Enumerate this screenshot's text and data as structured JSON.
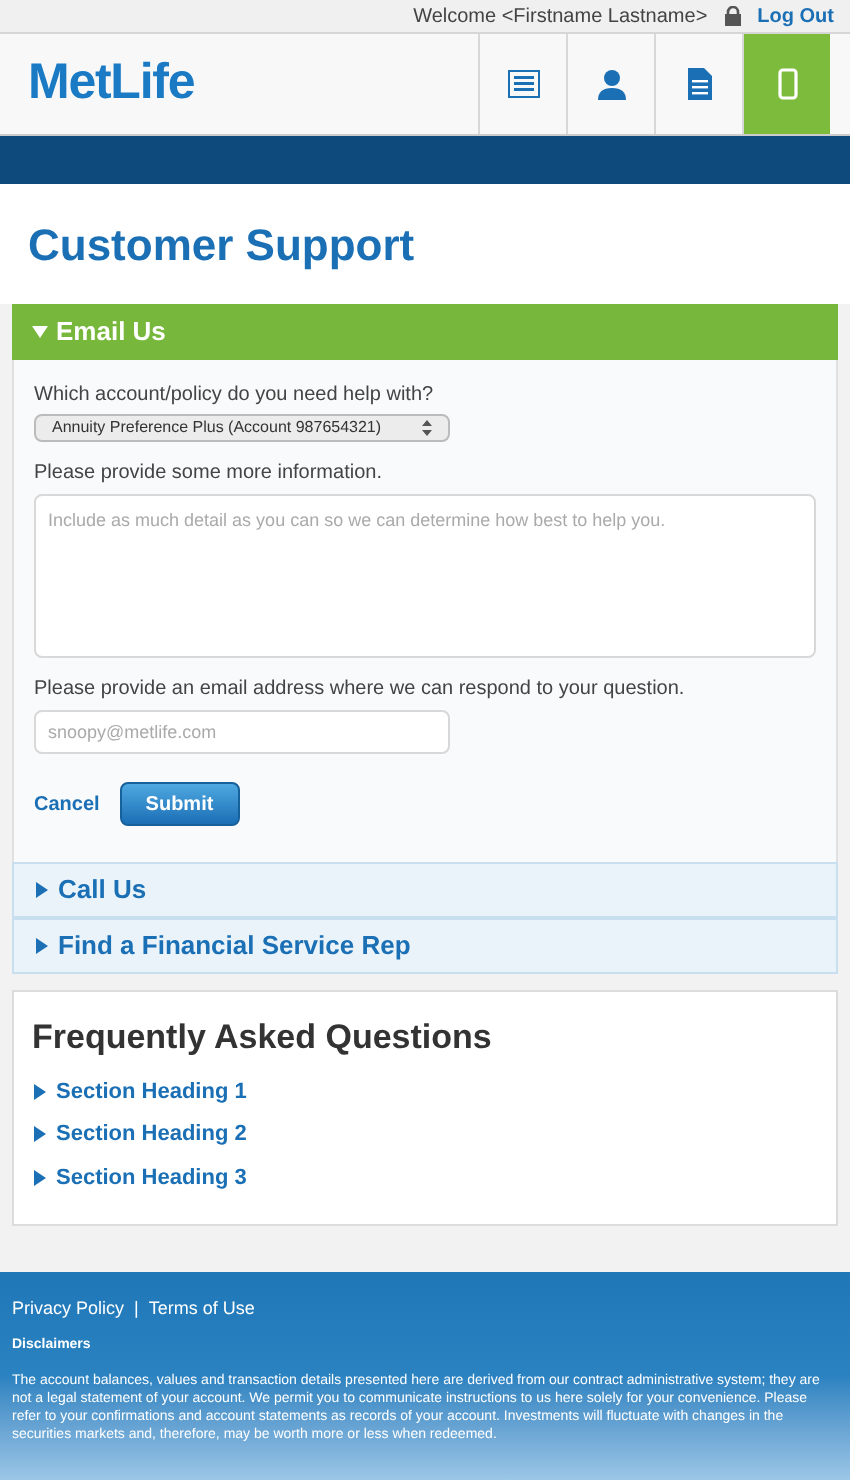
{
  "top_bar": {
    "welcome": "Welcome <Firstname Lastname>",
    "logout": "Log Out"
  },
  "header": {
    "logo": "MetLife",
    "nav": [
      {
        "kind": "list",
        "selected": false
      },
      {
        "kind": "person",
        "selected": false
      },
      {
        "kind": "document",
        "selected": false
      },
      {
        "kind": "phone",
        "selected": true
      }
    ]
  },
  "page_title": "Customer Support",
  "sections": [
    {
      "title": "Email Us",
      "expanded": true,
      "form": {
        "account_label": "Which account/policy do you need help with?",
        "account_value": "Annuity Preference Plus (Account 987654321)",
        "info_label": "Please provide some more information.",
        "info_placeholder": "Include as much detail as you can so we can determine how best to help you.",
        "email_label": "Please provide an email address where we can respond to your question.",
        "email_placeholder": "snoopy@metlife.com",
        "cancel": "Cancel",
        "submit": "Submit"
      }
    },
    {
      "title": "Call Us",
      "expanded": false
    },
    {
      "title": "Find a Financial Service Rep",
      "expanded": false
    }
  ],
  "faq": {
    "title": "Frequently Asked Questions",
    "items": [
      "Section Heading 1",
      "Section Heading 2",
      "Section Heading 3"
    ]
  },
  "footer": {
    "links": [
      "Privacy Policy",
      "Terms of Use"
    ],
    "separator": "|",
    "disclaimers_title": "Disclaimers",
    "disclaimer": "The account balances, values and transaction details presented here are derived from our contract administrative system; they are not a legal statement of your account. We permit you to communicate instructions to us here solely for your convenience. Please refer to your confirmations and account statements as records of your account. Investments will fluctuate with changes in the securities markets and, therefore, may be worth more or less when redeemed."
  }
}
